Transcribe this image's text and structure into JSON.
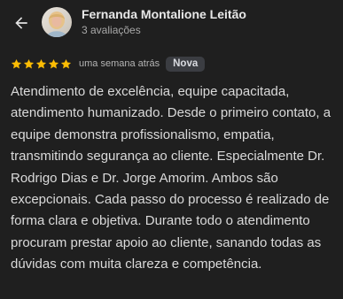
{
  "header": {
    "back_icon": "arrow-back-icon",
    "reviewer_name": "Fernanda Montalione Leitão",
    "review_count": "3 avaliações"
  },
  "review": {
    "rating": 5,
    "rating_max": 5,
    "star_color": "#fbbc04",
    "date": "uma semana atrás",
    "badge": "Nova",
    "text": "Atendimento de excelência, equipe capacitada, atendimento humanizado. Desde o primeiro contato, a equipe demonstra profissionalismo, empatia, transmitindo segurança ao cliente. Especialmente Dr. Rodrigo Dias e Dr. Jorge Amorim. Ambos são excepcionais. Cada passo do processo é realizado de forma clara e objetiva. Durante todo o atendimento procuram prestar apoio ao cliente, sanando todas as dúvidas com muita clareza e competência."
  }
}
